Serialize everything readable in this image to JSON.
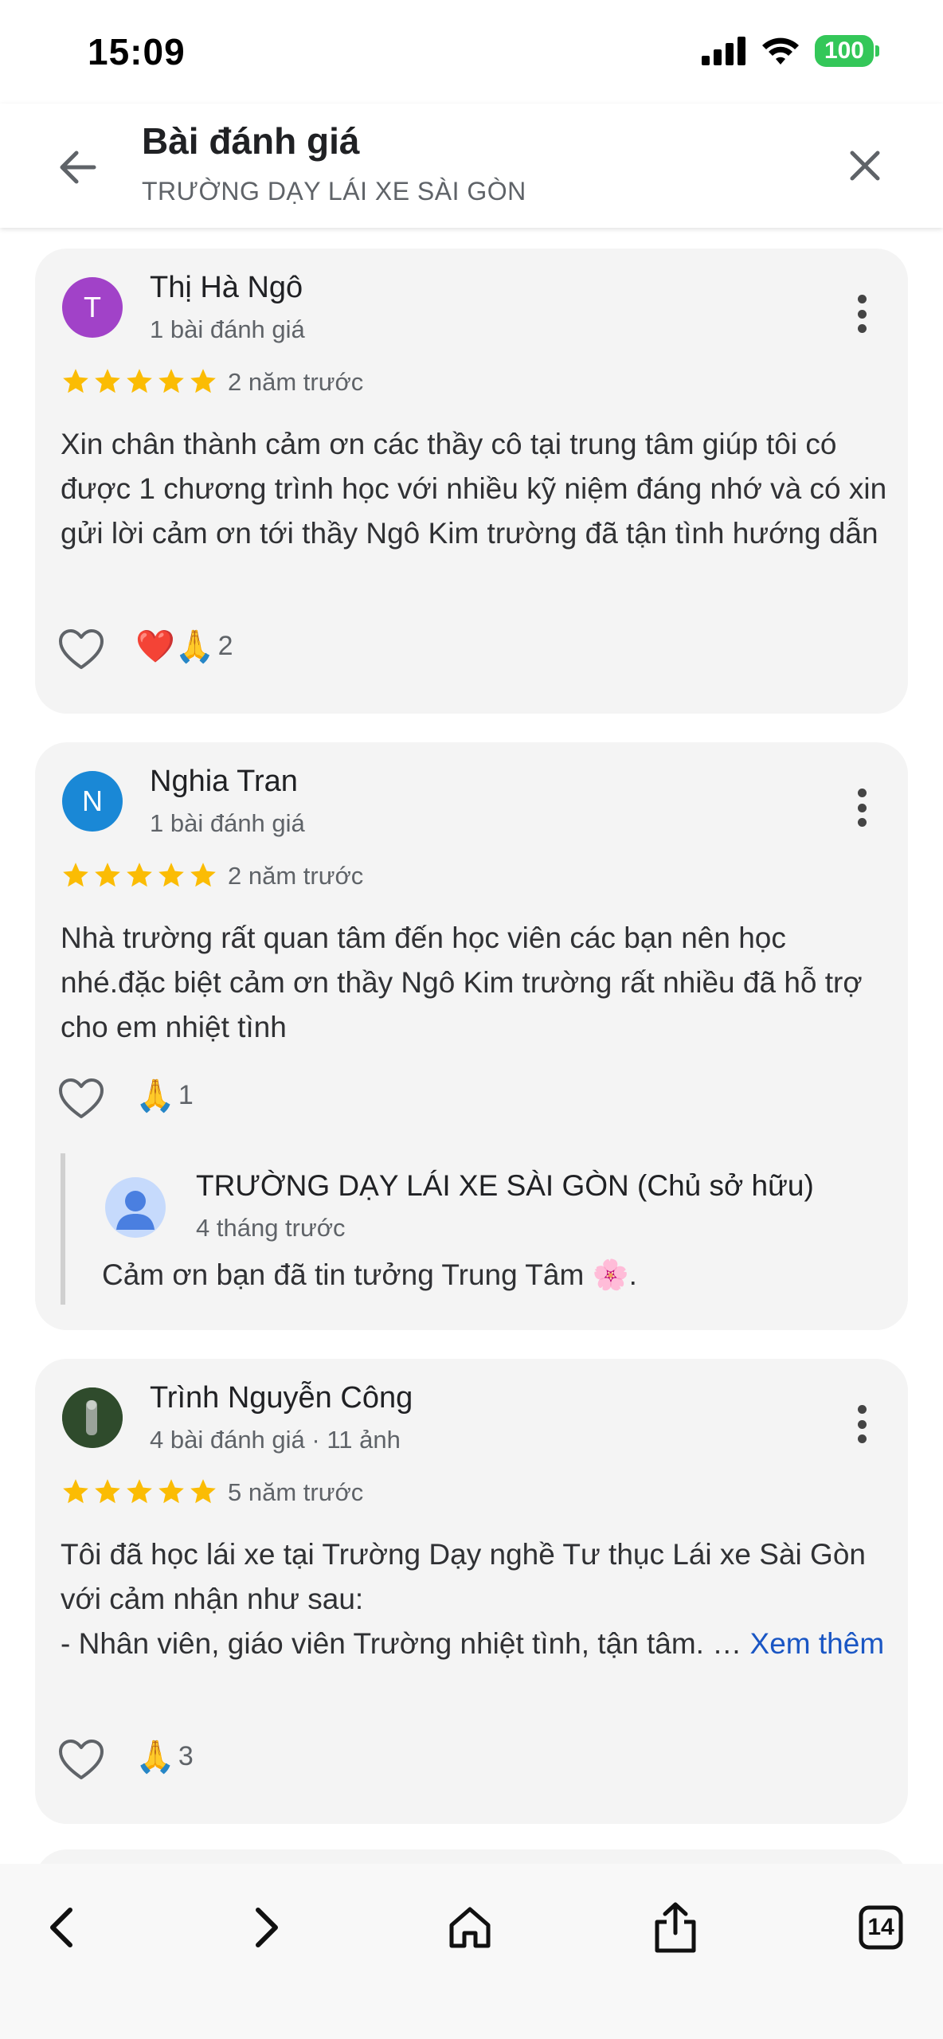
{
  "status": {
    "time": "15:09",
    "battery": "100"
  },
  "header": {
    "title": "Bài đánh giá",
    "subtitle": "TRƯỜNG DẠY LÁI XE SÀI GÒN",
    "back_icon": "arrow-left-icon",
    "close_icon": "close-icon"
  },
  "reviews": [
    {
      "avatar_letter": "T",
      "avatar_color": "#a142c8",
      "name": "Thị Hà Ngô",
      "meta": "1 bài đánh giá",
      "rating": 5,
      "age": "2 năm trước",
      "text": "Xin chân thành cảm ơn các thầy cô tại trung tâm giúp tôi có được 1 chương trình học với nhiều kỹ niệm đáng nhớ và có xin gửi lời cảm ơn tới thầy Ngô Kim trường đã tận tình hướng dẫn",
      "reactions": "❤️🙏",
      "reaction_count": "2"
    },
    {
      "avatar_letter": "N",
      "avatar_color": "#1a88d6",
      "name": "Nghia Tran",
      "meta": "1 bài đánh giá",
      "rating": 5,
      "age": "2 năm trước",
      "text": "Nhà trường rất quan tâm đến học viên các bạn nên học nhé.đặc biệt cảm ơn thầy Ngô Kim trường rất nhiều đã hỗ trợ cho em nhiệt tình",
      "reactions": "🙏",
      "reaction_count": "1",
      "owner_reply": {
        "name": "TRƯỜNG DẠY LÁI XE SÀI GÒN (Chủ sở hữu)",
        "age": "4 tháng trước",
        "text": "Cảm ơn bạn đã tin tưởng Trung Tâm 🌸."
      }
    },
    {
      "avatar_color": "#2f4b2c",
      "name": "Trình Nguyễn Công",
      "meta": "4 bài đánh giá · 11 ảnh",
      "rating": 5,
      "age": "5 năm trước",
      "text_lines": [
        "Tôi đã học lái xe tại Trường Dạy nghề Tư thục Lái xe Sài Gòn với cảm nhận như sau:",
        "- Nhân viên, giáo viên Trường nhiệt tình, tận tâm. … "
      ],
      "more_label": "Xem thêm",
      "reactions": "🙏",
      "reaction_count": "3"
    }
  ],
  "toolbar": {
    "back_icon": "chevron-left-icon",
    "forward_icon": "chevron-right-icon",
    "home_icon": "home-icon",
    "share_icon": "share-icon",
    "tabs_count": "14"
  }
}
